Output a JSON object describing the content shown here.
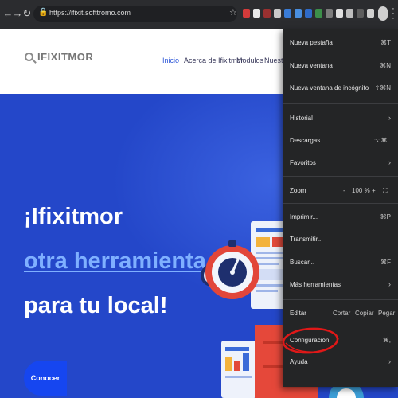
{
  "browser": {
    "url": "https://ifixit.softtromo.com",
    "nav_back_icon": "arrow-left-icon",
    "nav_forward_icon": "arrow-right-icon",
    "reload_icon": "reload-icon"
  },
  "site": {
    "logo_text": "IFIXITMOR",
    "nav": [
      "Inicio",
      "Acerca de Ifixitmor",
      "Modulos",
      "Nuestro"
    ]
  },
  "hero": {
    "line1": "¡Ifixitmor",
    "line2": "otra herramienta",
    "line3": "para tu local!",
    "cta_label": "Conocer"
  },
  "menu": {
    "new_tab": "Nueva pestaña",
    "new_tab_sc": "⌘T",
    "new_window": "Nueva ventana",
    "new_window_sc": "⌘N",
    "incognito": "Nueva ventana de incógnito",
    "incognito_sc": "⇧⌘N",
    "history": "Historial",
    "downloads": "Descargas",
    "downloads_sc": "⌥⌘L",
    "favorites": "Favoritos",
    "zoom": "Zoom",
    "zoom_minus": "-",
    "zoom_value": "100 %",
    "zoom_plus": "+",
    "print": "Imprimir...",
    "print_sc": "⌘P",
    "cast": "Transmitir...",
    "find": "Buscar...",
    "find_sc": "⌘F",
    "more_tools": "Más herramientas",
    "edit": "Editar",
    "cut": "Cortar",
    "copy": "Copiar",
    "paste": "Pegar",
    "settings": "Configuración",
    "settings_sc": "⌘,",
    "help": "Ayuda"
  },
  "colors": {
    "hero_bg": "#2447c9",
    "accent": "#7fb0ff",
    "cta": "#1646f0",
    "annotation": "#e01818"
  }
}
